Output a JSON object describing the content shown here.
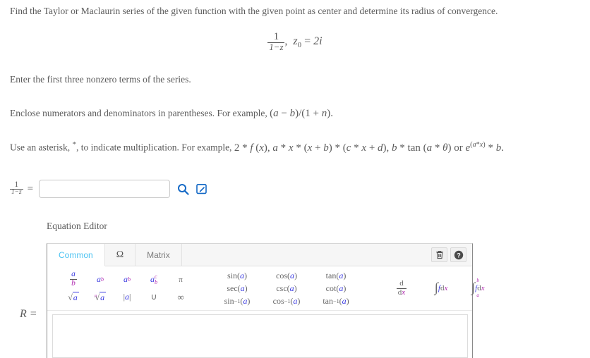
{
  "question": {
    "statement": "Find the Taylor or Maclaurin series of the given function with the given point as center and determine its radius of convergence.",
    "formula": {
      "numerator": "1",
      "denominator": "1−z",
      "center_var": "z",
      "center_sub": "0",
      "equals": "=",
      "center_value": "2i",
      "comma": ","
    },
    "instructions": [
      "Enter the first three nonzero terms of the series.",
      "Enclose numerators and denominators in parentheses. For example, (a − b)/(1 + n).",
      "Use an asterisk, *, to indicate multiplication. For example, 2 * f (x), a * x * (x + b) * (c * x + d), b * tan (a * θ) or e^(a*x) * b."
    ],
    "instruction_parts": {
      "enclose_prefix": "Enclose numerators and denominators in parentheses. For example,",
      "enclose_math": "(a − b)/(1 + n).",
      "asterisk_prefix": "Use an asterisk,",
      "asterisk_symbol": "*",
      "asterisk_mid": ", to indicate multiplication. For example,",
      "asterisk_math": "2 * f (x), a * x * (x + b) * (c * x + d), b * tan (a * θ) or e^(a*x) * b."
    }
  },
  "answer_row": {
    "lhs_numerator": "1",
    "lhs_denominator": "1−z",
    "equals": "=",
    "input_value": "",
    "input_placeholder": "",
    "search_icon": "magnifier-icon",
    "edit_icon": "pencil-square-icon",
    "icon_color": "#1469c6"
  },
  "equation_editor": {
    "title": "Equation Editor",
    "tabs": [
      {
        "id": "common",
        "label": "Common",
        "active": true
      },
      {
        "id": "omega",
        "label": "Ω",
        "active": false
      },
      {
        "id": "matrix",
        "label": "Matrix",
        "active": false
      }
    ],
    "active_tab_color": "#4cc3f2",
    "actions": [
      {
        "id": "clear",
        "icon": "trash-icon",
        "label": ""
      },
      {
        "id": "help",
        "icon": "question-mark-icon",
        "label": ""
      }
    ],
    "palette": {
      "basic": [
        {
          "id": "fraction",
          "label": "a/b",
          "num": "a",
          "den": "b"
        },
        {
          "id": "superscript",
          "base": "a",
          "sup": "b"
        },
        {
          "id": "subscript",
          "base": "a",
          "sub": "b"
        },
        {
          "id": "sub-superscript",
          "base": "a",
          "sub": "b",
          "sup": "c"
        },
        {
          "id": "pi",
          "label": "π"
        },
        {
          "id": "square-root",
          "base": "a",
          "index": ""
        },
        {
          "id": "nth-root",
          "base": "a",
          "index": "n"
        },
        {
          "id": "absolute-value",
          "base": "a",
          "label": "|a|"
        },
        {
          "id": "union",
          "label": "∪"
        },
        {
          "id": "infinity",
          "label": "∞"
        }
      ],
      "trig": [
        {
          "id": "sin",
          "name": "sin",
          "arg": "a"
        },
        {
          "id": "cos",
          "name": "cos",
          "arg": "a"
        },
        {
          "id": "tan",
          "name": "tan",
          "arg": "a"
        },
        {
          "id": "sec",
          "name": "sec",
          "arg": "a"
        },
        {
          "id": "csc",
          "name": "csc",
          "arg": "a"
        },
        {
          "id": "cot",
          "name": "cot",
          "arg": "a"
        },
        {
          "id": "arcsin",
          "name": "sin",
          "exp": "−1",
          "arg": "a"
        },
        {
          "id": "arccos",
          "name": "cos",
          "exp": "−1",
          "arg": "a"
        },
        {
          "id": "arctan",
          "name": "tan",
          "exp": "−1",
          "arg": "a"
        }
      ],
      "calculus": [
        {
          "id": "derivative",
          "num": "d",
          "den": "dx"
        },
        {
          "id": "indefinite-integral",
          "symbol": "∫",
          "body": "f dx"
        },
        {
          "id": "definite-integral",
          "symbol": "∫",
          "upper": "b",
          "lower": "a",
          "body": "f dx"
        }
      ]
    },
    "canvas_value": "",
    "colors": {
      "variable_blue": "#3a3ae0",
      "variable_magenta": "#b02ab0",
      "toolbar_bg": "#f6f6f6"
    }
  },
  "radius_row": {
    "label": "R =",
    "input_value": ""
  }
}
